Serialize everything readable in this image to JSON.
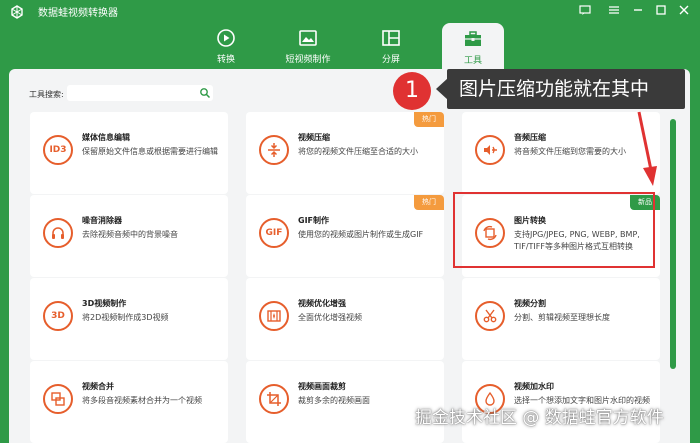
{
  "app": {
    "title": "数据蛙视频转换器"
  },
  "window_controls": [
    "message-icon",
    "menu-icon",
    "minimize-icon",
    "maximize-icon",
    "close-icon"
  ],
  "nav": {
    "tabs": [
      {
        "label": "转换",
        "icon": "convert-icon"
      },
      {
        "label": "短视频制作",
        "icon": "short-video-icon"
      },
      {
        "label": "分屏",
        "icon": "split-screen-icon"
      },
      {
        "label": "工具",
        "icon": "toolbox-icon",
        "active": true
      }
    ]
  },
  "search": {
    "label": "工具搜索:",
    "value": "",
    "placeholder": ""
  },
  "cards": [
    {
      "title": "媒体信息编辑",
      "desc": "保留原始文件信息或根据需要进行编辑",
      "icon_text": "ID3",
      "badge": ""
    },
    {
      "title": "视频压缩",
      "desc": "将您的视频文件压缩至合适的大小",
      "icon_text": "",
      "icon": "compress-icon",
      "badge": "热门"
    },
    {
      "title": "音频压缩",
      "desc": "将音频文件压缩到您需要的大小",
      "icon_text": "",
      "icon": "audio-compress-icon",
      "badge": ""
    },
    {
      "title": "噪音消除器",
      "desc": "去除视频音频中的背景噪音",
      "icon_text": "",
      "icon": "headphones-icon",
      "badge": ""
    },
    {
      "title": "GIF制作",
      "desc": "使用您的视频或图片制作或生成GIF",
      "icon_text": "GIF",
      "badge": "热门"
    },
    {
      "title": "图片转换",
      "desc": "支持JPG/JPEG, PNG, WEBP, BMP, TIF/TIFF等多种图片格式互相转换",
      "icon_text": "",
      "icon": "image-convert-icon",
      "badge": "新品"
    },
    {
      "title": "3D视频制作",
      "desc": "将2D视频制作成3D视频",
      "icon_text": "3D",
      "badge": ""
    },
    {
      "title": "视频优化增强",
      "desc": "全面优化增强视频",
      "icon_text": "",
      "icon": "enhance-icon",
      "badge": ""
    },
    {
      "title": "视频分割",
      "desc": "分割、剪辑视频至理想长度",
      "icon_text": "",
      "icon": "scissors-icon",
      "badge": ""
    },
    {
      "title": "视频合并",
      "desc": "将多段音视频素材合并为一个视频",
      "icon_text": "",
      "icon": "merge-icon",
      "badge": ""
    },
    {
      "title": "视频画面裁剪",
      "desc": "裁剪多余的视频画面",
      "icon_text": "",
      "icon": "crop-icon",
      "badge": ""
    },
    {
      "title": "视频加水印",
      "desc": "选择一个想添加文字和图片水印的视频",
      "icon_text": "",
      "icon": "watermark-icon",
      "badge": ""
    }
  ],
  "callout": {
    "number": "1",
    "text": "图片压缩功能就在其中"
  },
  "watermark": "掘金技术社区 @ 数据蛙官方软件",
  "colors": {
    "brand": "#2f9a47",
    "accent": "#e65e2c",
    "hot": "#f49b3e",
    "highlight": "#e03232"
  }
}
